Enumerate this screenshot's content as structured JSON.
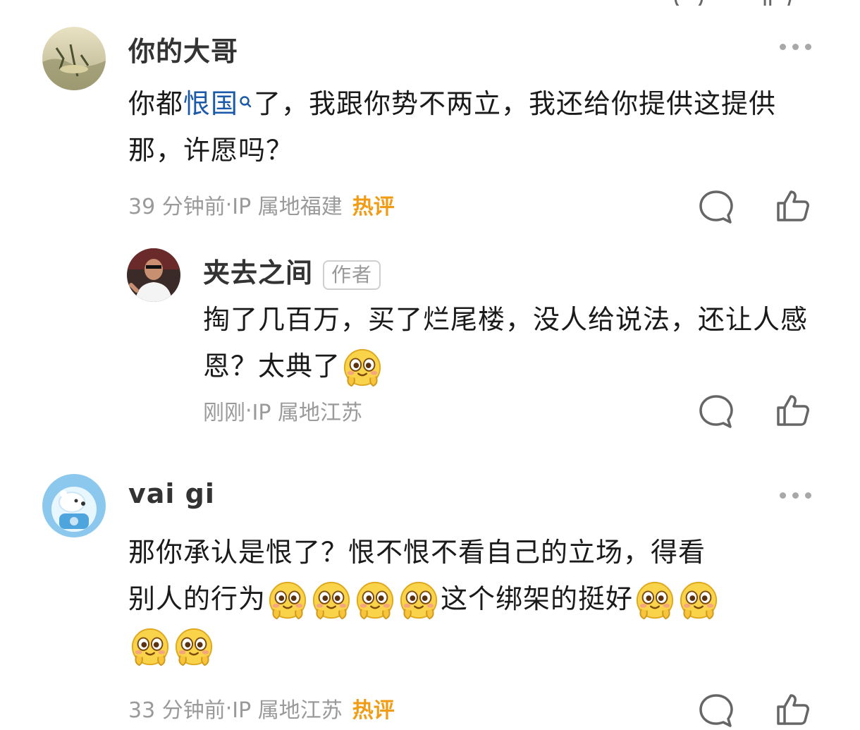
{
  "comments": [
    {
      "username": "你的大哥",
      "text_before": "你都",
      "topic": "恨国",
      "text_after": "了，我跟你势不两立，我还给你提供这提供那，许愿吗？",
      "time": "39 分钟前",
      "ip": "IP 属地福建",
      "hot": "热评",
      "reply": {
        "username": "夹去之间",
        "badge": "作者",
        "text": "掏了几百万，买了烂尾楼，没人给说法，还让人感恩？太典了",
        "time": "刚刚",
        "ip": "IP 属地江苏"
      }
    },
    {
      "username": "vai gi",
      "line1": "那你承认是恨了？恨不恨不看自己的立场，得看",
      "line2a": "别人的行为",
      "line2b": "这个绑架的挺好",
      "time": "33 分钟前",
      "ip": "IP 属地江苏",
      "hot": "热评"
    }
  ],
  "separator": " · ",
  "icons": {
    "comment": "comment-bubble-icon",
    "like": "thumbs-up-icon",
    "more": "more-dots-icon",
    "emoji": "smitten-face-emoji",
    "topic": "search-link-icon"
  },
  "colors": {
    "topic_link": "#1a5aa8",
    "hot_label": "#f09c15",
    "meta_gray": "#9a9a9a"
  }
}
